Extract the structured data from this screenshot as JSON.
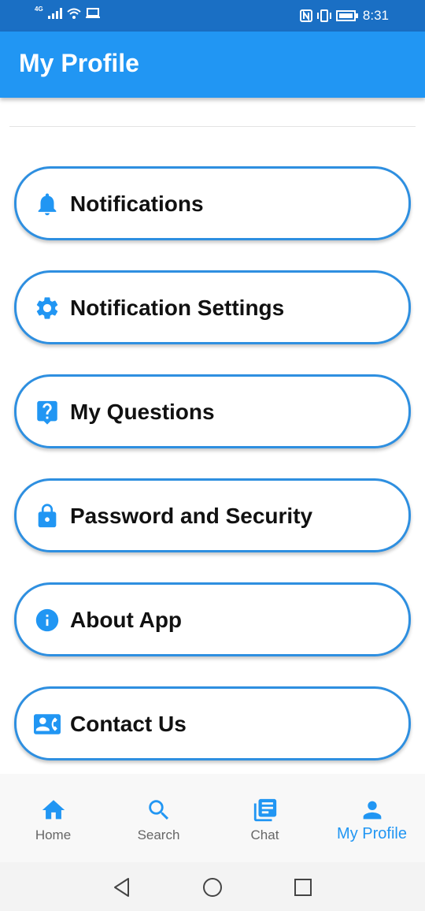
{
  "status_bar": {
    "network": "4G",
    "time": "8:31",
    "icons": [
      "signal-icon",
      "wifi-icon",
      "cast-icon",
      "nfc-icon",
      "vibrate-icon",
      "battery-icon"
    ]
  },
  "app_bar": {
    "title": "My Profile"
  },
  "menu": {
    "items": [
      {
        "label": "Notifications",
        "icon": "bell-icon"
      },
      {
        "label": "Notification Settings",
        "icon": "gear-icon"
      },
      {
        "label": "My Questions",
        "icon": "question-icon"
      },
      {
        "label": "Password and Security",
        "icon": "lock-icon"
      },
      {
        "label": "About App",
        "icon": "info-icon"
      },
      {
        "label": "Contact Us",
        "icon": "contact-phone-icon"
      }
    ]
  },
  "bottom_nav": {
    "items": [
      {
        "label": "Home",
        "icon": "home-icon"
      },
      {
        "label": "Search",
        "icon": "search-icon"
      },
      {
        "label": "Chat",
        "icon": "chat-icon"
      },
      {
        "label": "My Profile",
        "icon": "person-icon"
      }
    ],
    "active": "My Profile"
  },
  "system_nav": {
    "icons": [
      "back-icon",
      "home-circle-icon",
      "recents-icon"
    ]
  },
  "colors": {
    "primary": "#2196f3",
    "status_bar": "#1a6fc4",
    "border": "#2e8fe0",
    "text": "#111111",
    "inactive": "#666666"
  }
}
